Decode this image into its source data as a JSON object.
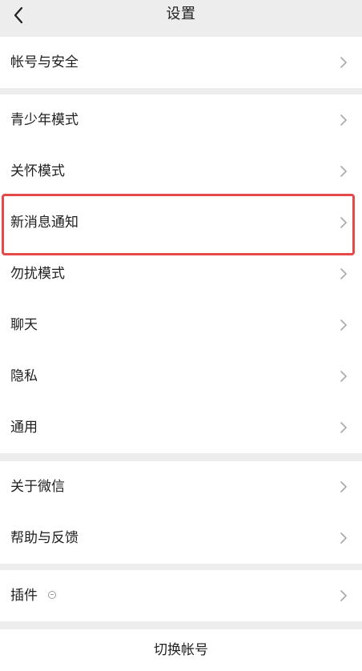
{
  "header": {
    "title": "设置",
    "back_icon": "back-arrow-icon"
  },
  "groups": [
    {
      "items": [
        {
          "label": "帐号与安全"
        }
      ]
    },
    {
      "items": [
        {
          "label": "青少年模式"
        },
        {
          "label": "关怀模式"
        },
        {
          "label": "新消息通知",
          "highlighted": true
        },
        {
          "label": "勿扰模式"
        },
        {
          "label": "聊天"
        },
        {
          "label": "隐私"
        },
        {
          "label": "通用"
        }
      ]
    },
    {
      "items": [
        {
          "label": "关于微信"
        },
        {
          "label": "帮助与反馈"
        }
      ]
    },
    {
      "items": [
        {
          "label": "插件",
          "badge_icon": "plugin-status-icon"
        }
      ]
    }
  ],
  "footer": {
    "switch_account_label": "切换帐号"
  },
  "colors": {
    "background": "#ededed",
    "card": "#ffffff",
    "highlight": "#e44a4a",
    "text": "#202020",
    "chevron": "#a8a8a8"
  }
}
